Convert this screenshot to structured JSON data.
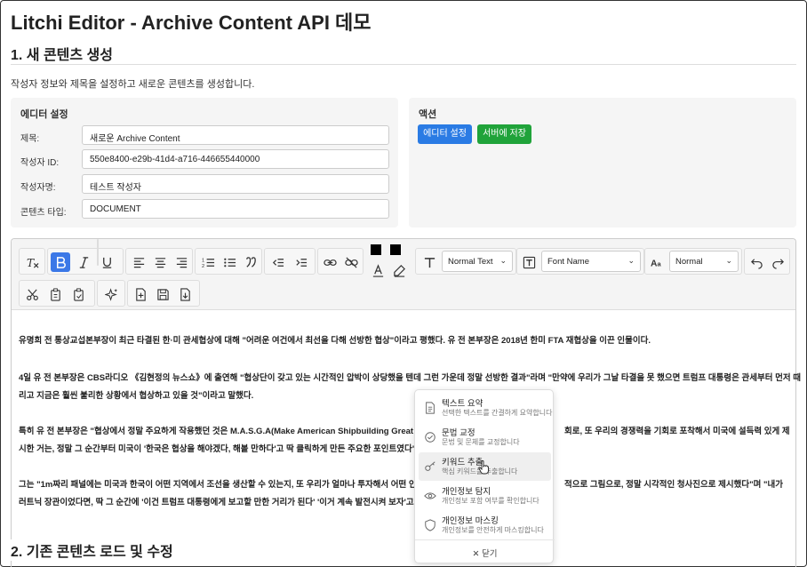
{
  "page": {
    "title": "Litchi Editor - Archive Content API 데모",
    "section1_title": "1. 새 콘텐츠 생성",
    "section1_desc": "작성자 정보와 제목을 설정하고 새로운 콘텐츠를 생성합니다.",
    "section2_title": "2. 기존 콘텐츠 로드 및 수정"
  },
  "settings": {
    "panel_title": "에디터 설정",
    "fields": [
      {
        "label": "제목:",
        "value": "새로운 Archive Content"
      },
      {
        "label": "작성자 ID:",
        "value": "550e8400-e29b-41d4-a716-446655440000"
      },
      {
        "label": "작성자명:",
        "value": "테스트 작성자"
      },
      {
        "label": "콘텐츠 타입:",
        "value": "DOCUMENT"
      }
    ]
  },
  "actions": {
    "panel_title": "액션",
    "editor_settings_label": "에디터 설정",
    "save_label": "서버에 저장"
  },
  "toolbar": {
    "block_type": "Normal Text",
    "font_name": "Font Name",
    "font_size": "Normal",
    "text_color": "#000000",
    "highlight_color": "#000000",
    "bold_active": true
  },
  "content": {
    "paragraphs": [
      "유명희 전 통상교섭본부장이 최근 타결된 한·미 관세협상에 대해 \"어려운 여건에서 최선을 다해 선방한 협상\"이라고 평했다. 유 전 본부장은 2018년 한미 FTA 재협상을 이끈 인물이다.",
      "4일 유 전 본부장은 CBS라디오 《김현정의 뉴스쇼》에 출연해 \"협상단이 갖고 있는 시간적인 압박이 상당했을 텐데 그런 가운데 정말 선방한 결과\"라며 \"만약에 우리가 그날 타결을 못 했으면 트럼프 대통령은 관세부터 먼저 때",
      "리고 지금은 훨씬 불리한 상황에서 협상하고 있을 것\"이라고 말했다.",
      "특히 유 전 본부장은 \"협상에서 정말 주요하게 작용했던 것은 M.A.S.G.A(Make American Shipbuilding Great",
      "회로, 또 우리의 경쟁력을 기회로 포착해서 미국에 설득력 있게 제",
      "시한 거는, 정말 그 순간부터 미국이 '한국은 협상을 해야겠다, 해볼 만하다'고 딱 클릭하게 만든 주요한 포인트였다\"고",
      "그는 \"1m짜리 패널에는 미국과 한국이 어떤 지역에서 조선을 생산할 수 있는지, 또 우리가 얼마나 투자해서 어떤 인력",
      "적으로 그림으로, 정말 시각적인 청사진으로 제시했다\"며 \"내가",
      "러트닉 장관이었다면, 딱 그 순간에 '이건 트럼프 대통령에게 보고할 만한 거리가 된다' '이거 계속 발전시켜 보자'고 생"
    ]
  },
  "context_menu": {
    "items": [
      {
        "title": "텍스트 요약",
        "desc": "선택한 텍스트를 간결하게 요약합니다",
        "icon": "document-icon"
      },
      {
        "title": "문법 교정",
        "desc": "문법 및 문체를 교정합니다",
        "icon": "check-circle-icon"
      },
      {
        "title": "키워드 추출",
        "desc": "핵심 키워드를 추출합니다",
        "icon": "key-icon"
      },
      {
        "title": "개인정보 탐지",
        "desc": "개인정보 포함 여부를 확인합니다",
        "icon": "eye-icon"
      },
      {
        "title": "개인정보 마스킹",
        "desc": "개인정보를 안전하게 마스킹합니다",
        "icon": "shield-icon"
      }
    ],
    "close_label": "닫기"
  }
}
